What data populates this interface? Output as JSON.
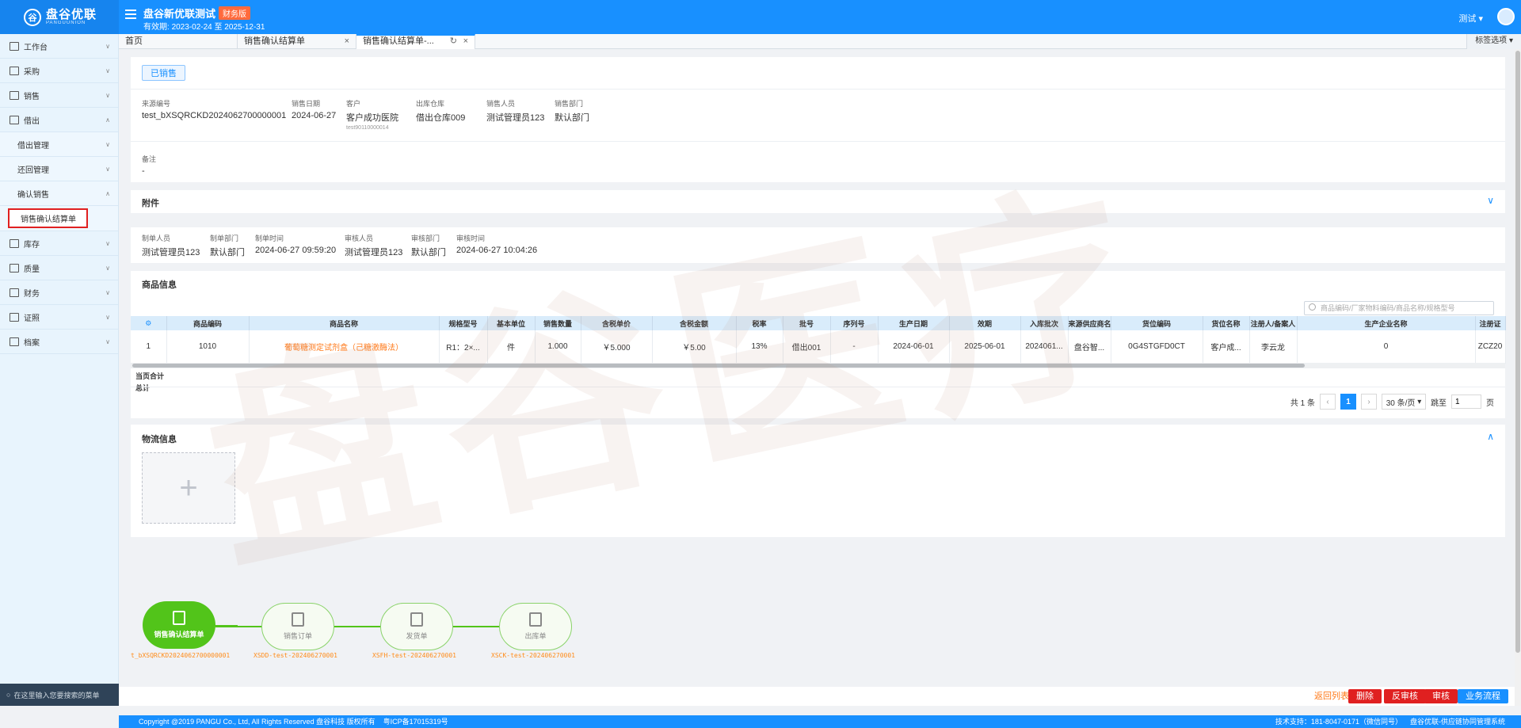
{
  "header": {
    "logo_text": "盘谷优联",
    "logo_sub": "PANGUUNION",
    "org_title": "盘谷新优联测试",
    "org_badge": "财务版",
    "valid_label": "有效期:",
    "valid_range": "2023-02-24 至 2025-12-31",
    "user_name": "测试"
  },
  "sidebar": {
    "items": [
      {
        "label": "工作台"
      },
      {
        "label": "采购"
      },
      {
        "label": "销售"
      },
      {
        "label": "借出"
      }
    ],
    "sub_items": [
      {
        "label": "借出管理"
      },
      {
        "label": "还回管理"
      },
      {
        "label": "确认销售"
      }
    ],
    "active_item": "销售确认结算单",
    "items_after": [
      {
        "label": "库存"
      },
      {
        "label": "质量"
      },
      {
        "label": "财务"
      },
      {
        "label": "证照"
      },
      {
        "label": "档案"
      }
    ],
    "search_placeholder": "在这里输入您要搜索的菜单"
  },
  "tabs": {
    "items": [
      {
        "label": "首页"
      },
      {
        "label": "销售确认结算单"
      },
      {
        "label": "销售确认结算单-..."
      }
    ],
    "options_label": "标签选项"
  },
  "status": {
    "label": "已销售"
  },
  "order": {
    "fields": [
      {
        "label": "来源编号",
        "value": "test_bXSQRCKD2024062700000001"
      },
      {
        "label": "销售日期",
        "value": "2024-06-27"
      },
      {
        "label": "客户",
        "value": "客户成功医院",
        "sub": "test90110000014"
      },
      {
        "label": "出库仓库",
        "value": "借出仓库009"
      },
      {
        "label": "销售人员",
        "value": "测试管理员123"
      },
      {
        "label": "销售部门",
        "value": "默认部门"
      }
    ],
    "remark_label": "备注",
    "remark_value": "-"
  },
  "attachment": {
    "title": "附件"
  },
  "audit": {
    "fields": [
      {
        "label": "制单人员",
        "value": "测试管理员123"
      },
      {
        "label": "制单部门",
        "value": "默认部门"
      },
      {
        "label": "制单时间",
        "value": "2024-06-27 09:59:20"
      },
      {
        "label": "审核人员",
        "value": "测试管理员123"
      },
      {
        "label": "审核部门",
        "value": "默认部门"
      },
      {
        "label": "审核时间",
        "value": "2024-06-27 10:04:26"
      }
    ]
  },
  "goods": {
    "title": "商品信息",
    "search_placeholder": "商品编码/厂家物料编码/商品名称/规格型号",
    "columns": [
      "商品编码",
      "商品名称",
      "规格型号",
      "基本单位",
      "销售数量",
      "含税单价",
      "含税金额",
      "税率",
      "批号",
      "序列号",
      "生产日期",
      "效期",
      "入库批次",
      "来源供应商名",
      "货位编码",
      "货位名称",
      "注册人/备案人",
      "生产企业名称",
      "注册证"
    ],
    "rows": [
      [
        "1",
        "1010",
        "葡萄糖测定试剂盒（己糖激酶法）",
        "R1：2×...",
        "件",
        "1.000",
        "￥5.000",
        "￥5.00",
        "13%",
        "借出001",
        "-",
        "2024-06-01",
        "2025-06-01",
        "2024061...",
        "盘谷智...",
        "0G4STGFD0CT",
        "客户成...",
        "李云龙",
        "0",
        "ZCZ20"
      ]
    ],
    "page_total_label": "当页合计",
    "total_label": "总计"
  },
  "pagination": {
    "total": "共 1 条",
    "current_page": "1",
    "page_size": "30 条/页",
    "jump_label": "跳至",
    "jump_value": "1",
    "page_unit": "页"
  },
  "logistics": {
    "title": "物流信息"
  },
  "flow": {
    "nodes": [
      {
        "label": "销售确认结算单",
        "code": "t_bXSQRCKD2024062700000001"
      },
      {
        "label": "销售订单",
        "code": "XSDD-test-202406270001"
      },
      {
        "label": "发货单",
        "code": "XSFH-test-202406270001"
      },
      {
        "label": "出库单",
        "code": "XSCK-test-202406270001"
      }
    ]
  },
  "actions": {
    "back": "返回列表",
    "delete": "删除",
    "reverse": "反审核",
    "audit": "审核",
    "flow": "业务流程"
  },
  "watermark": "盘谷医疗",
  "footer": {
    "copyright": "Copyright @2019 PANGU Co., Ltd, All Rights Reserved 盘谷科技 版权所有",
    "icp": "粤ICP备17015319号",
    "support": "技术支持：181-8047-0171（微信同号）",
    "system": "盘谷优联-供应链协同管理系统"
  },
  "colors": {
    "primary": "#1890ff",
    "success": "#52c41a",
    "link_orange": "#ff7a1a",
    "highlight_red": "#e02020"
  }
}
